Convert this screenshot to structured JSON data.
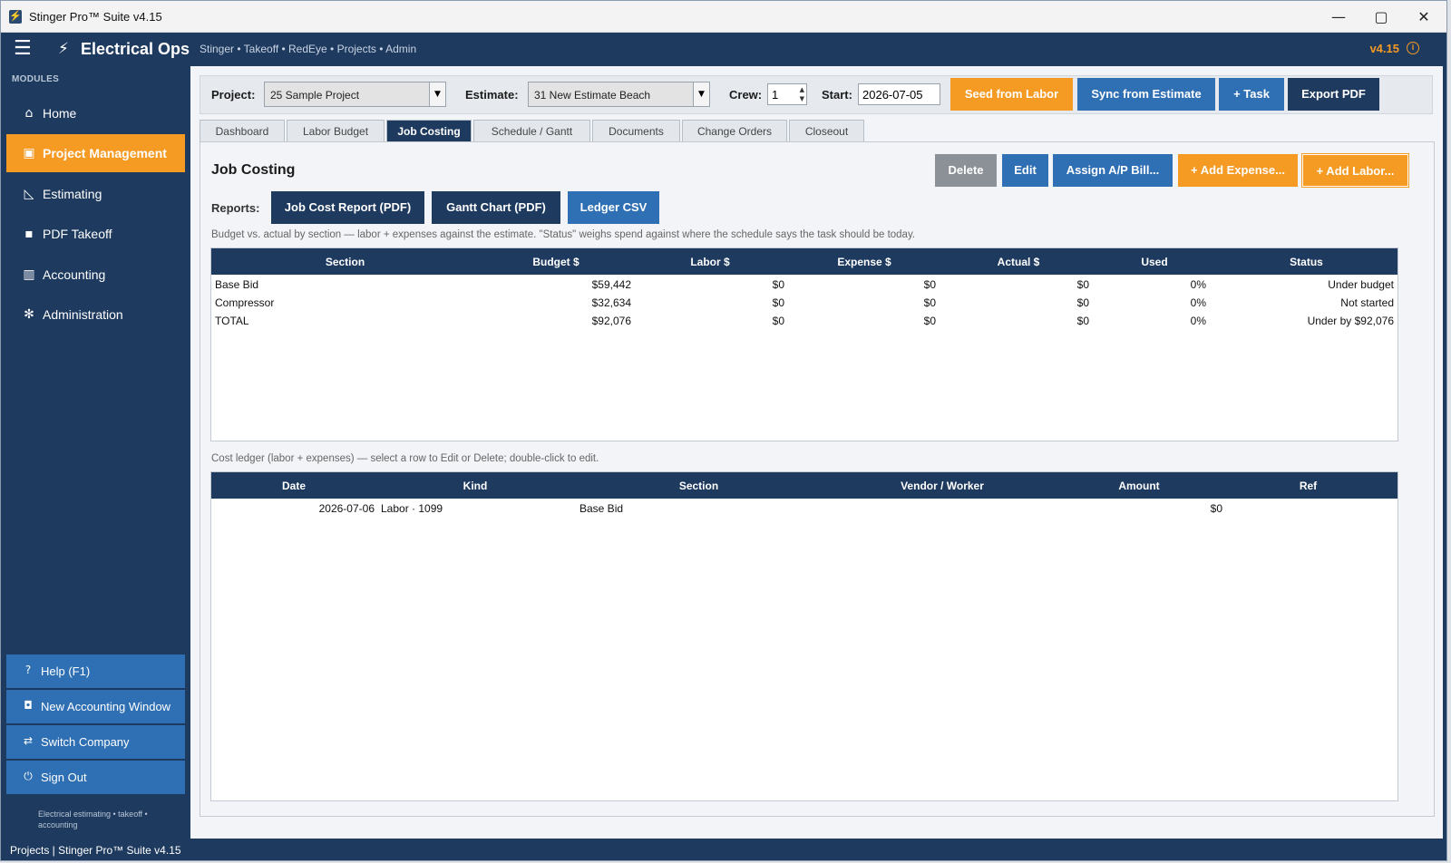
{
  "window": {
    "title": "Stinger Pro™ Suite v4.15",
    "app_icon_glyph": "⚡",
    "minimize_glyph": "—",
    "maximize_glyph": "▢",
    "close_glyph": "✕"
  },
  "header": {
    "menu_glyph": "☰",
    "bolt_glyph": "⚡",
    "brand": "Electrical Ops",
    "breadcrumbs": "Stinger • Takeoff • RedEye • Projects • Admin",
    "version": "v4.15",
    "info_glyph": "i"
  },
  "sidebar": {
    "modules_label": "MODULES",
    "items": [
      {
        "icon": "⌂",
        "label": "Home"
      },
      {
        "icon": "▣",
        "label": "Project Management"
      },
      {
        "icon": "◺",
        "label": "Estimating"
      },
      {
        "icon": "▪",
        "label": "PDF Takeoff"
      },
      {
        "icon": "▥",
        "label": "Accounting"
      },
      {
        "icon": "✻",
        "label": "Administration"
      }
    ],
    "bottom_buttons": [
      {
        "icon": "?",
        "label": "Help  (F1)"
      },
      {
        "icon": "◘",
        "label": "New Accounting Window"
      },
      {
        "icon": "⇄",
        "label": "Switch Company"
      },
      {
        "icon": "⏻",
        "label": "Sign Out"
      }
    ],
    "tagline": "Electrical estimating • takeoff • accounting"
  },
  "status_bar": "Projects  |  Stinger Pro™ Suite v4.15",
  "toolbar": {
    "project_label": "Project:",
    "project_value": "25  Sample Project",
    "estimate_label": "Estimate:",
    "estimate_value": "31  New Estimate Beach",
    "crew_label": "Crew:",
    "crew_value": "1",
    "start_label": "Start:",
    "start_value": "2026-07-05",
    "dropdown_glyph": "▼",
    "spin_glyph_up": "▲",
    "spin_glyph_down": "▼",
    "buttons": {
      "seed": "Seed from Labor",
      "sync": "Sync from Estimate",
      "task": "+ Task",
      "export": "Export PDF"
    }
  },
  "tabs": [
    "Dashboard",
    "Labor Budget",
    "Job Costing",
    "Schedule / Gantt",
    "Documents",
    "Change Orders",
    "Closeout"
  ],
  "job_costing": {
    "title": "Job Costing",
    "actions": {
      "delete": "Delete",
      "edit": "Edit",
      "assign": "Assign A/P Bill...",
      "add_expense": "+ Add Expense...",
      "add_labor": "+ Add Labor..."
    },
    "reports_label": "Reports:",
    "reports": {
      "job_cost": "Job Cost Report (PDF)",
      "gantt": "Gantt Chart (PDF)",
      "ledger": "Ledger CSV"
    },
    "budget_note": "Budget vs. actual by section — labor + expenses against the estimate. \"Status\" weighs spend against where the schedule says the task should be today.",
    "budget_columns": [
      "Section",
      "Budget $",
      "Labor $",
      "Expense $",
      "Actual $",
      "Used",
      "Status"
    ],
    "budget_rows": [
      [
        "Base Bid",
        "$59,442",
        "$0",
        "$0",
        "$0",
        "0%",
        "Under budget"
      ],
      [
        "Compressor",
        "$32,634",
        "$0",
        "$0",
        "$0",
        "0%",
        "Not started"
      ],
      [
        "TOTAL",
        "$92,076",
        "$0",
        "$0",
        "$0",
        "0%",
        "Under by $92,076"
      ]
    ],
    "ledger_note": "Cost ledger (labor + expenses) — select a row to Edit or Delete; double-click to edit.",
    "ledger_columns": [
      "Date",
      "Kind",
      "Section",
      "Vendor / Worker",
      "Amount",
      "Ref"
    ],
    "ledger_rows": [
      [
        "2026-07-06",
        "Labor · 1099",
        "Base Bid",
        "",
        "$0",
        ""
      ]
    ]
  }
}
